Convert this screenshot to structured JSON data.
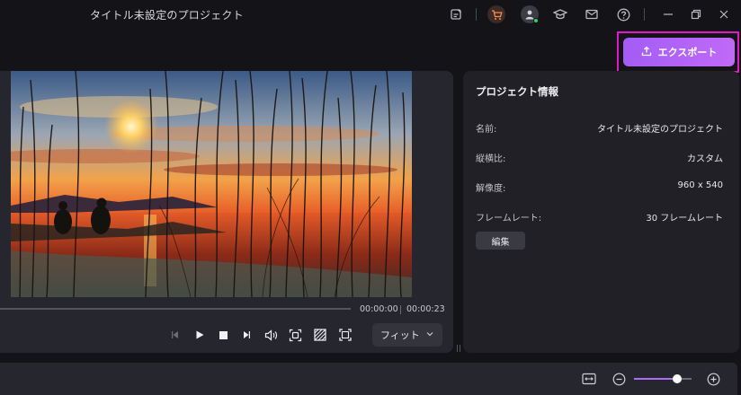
{
  "window": {
    "title": "タイトル未設定のプロジェクト"
  },
  "toolbar": {
    "icons": [
      "notes-icon",
      "cart-icon",
      "user-icon",
      "learn-icon",
      "mail-icon",
      "help-icon",
      "minimize-icon",
      "restore-icon",
      "close-icon"
    ]
  },
  "export": {
    "label": "エクスポート",
    "accent": "#b064f6",
    "highlight": "#e018c8"
  },
  "player": {
    "current_time": "00:00:00",
    "total_time": "00:00:23",
    "fit_label": "フィット",
    "controls": [
      "prev-frame-icon",
      "play-icon",
      "stop-icon",
      "next-frame-icon",
      "volume-icon",
      "snapshot-icon",
      "aspect-icon",
      "fullscreen-icon"
    ]
  },
  "project_info": {
    "title": "プロジェクト情報",
    "rows": [
      {
        "label": "名前:",
        "value": "タイトル未設定のプロジェクト"
      },
      {
        "label": "縦横比:",
        "value": "カスタム"
      },
      {
        "label": "解像度:",
        "value": "960 x 540"
      },
      {
        "label": "フレームレート:",
        "value": "30 フレームレート"
      }
    ],
    "edit_label": "編集"
  },
  "timeline": {
    "zoom_level": 0.75
  }
}
